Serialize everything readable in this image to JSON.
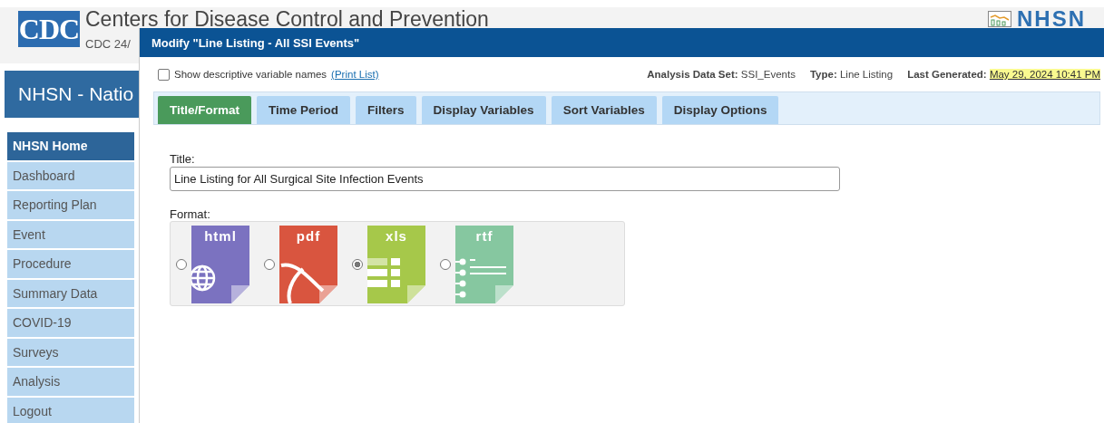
{
  "header": {
    "agency": "Centers for Disease Control and Prevention",
    "tagline": "CDC 24/",
    "logo_text": "CDC",
    "brand": "NHSN"
  },
  "banner": {
    "title": "NHSN - Natio"
  },
  "sidebar": {
    "items": [
      {
        "label": "NHSN Home",
        "selected": true
      },
      {
        "label": "Dashboard",
        "selected": false
      },
      {
        "label": "Reporting Plan",
        "selected": false
      },
      {
        "label": "Event",
        "selected": false
      },
      {
        "label": "Procedure",
        "selected": false
      },
      {
        "label": "Summary Data",
        "selected": false
      },
      {
        "label": "COVID-19",
        "selected": false
      },
      {
        "label": "Surveys",
        "selected": false
      },
      {
        "label": "Analysis",
        "selected": false
      },
      {
        "label": "Logout",
        "selected": false
      }
    ]
  },
  "dialog": {
    "title": "Modify \"Line Listing - All SSI Events\"",
    "show_descriptive": {
      "label": "Show descriptive variable names",
      "checked": false,
      "link": "(Print List)"
    },
    "info": [
      {
        "label": "Analysis Data Set:",
        "value": "SSI_Events",
        "kind": "plain"
      },
      {
        "label": "Type:",
        "value": "Line Listing",
        "kind": "plain"
      },
      {
        "label": "Last Generated:",
        "value": "May 29, 2024 10:41 PM",
        "kind": "link"
      }
    ],
    "tabs": [
      {
        "label": "Title/Format",
        "selected": true
      },
      {
        "label": "Time Period",
        "selected": false
      },
      {
        "label": "Filters",
        "selected": false
      },
      {
        "label": "Display Variables",
        "selected": false
      },
      {
        "label": "Sort Variables",
        "selected": false
      },
      {
        "label": "Display Options",
        "selected": false
      }
    ],
    "title_label": "Title:",
    "title_value": "Line Listing for All Surgical Site Infection Events",
    "format_label": "Format:",
    "formats": [
      {
        "label": "html",
        "kind": "globe",
        "color": "#7b72c0",
        "selected": false
      },
      {
        "label": "pdf",
        "kind": "swoosh",
        "color": "#d9553f",
        "selected": false
      },
      {
        "label": "xls",
        "kind": "grid",
        "color": "#a6c84a",
        "selected": true
      },
      {
        "label": "rtf",
        "kind": "lines",
        "color": "#86c7a0",
        "selected": false
      }
    ]
  }
}
